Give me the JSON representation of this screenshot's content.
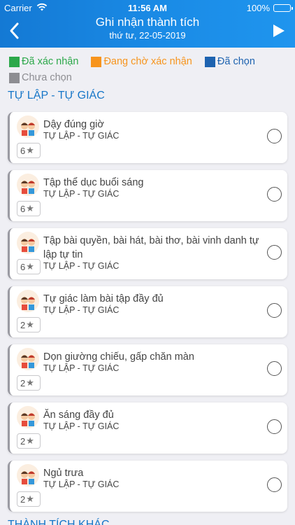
{
  "status_bar": {
    "carrier": "Carrier",
    "time": "11:56 AM",
    "battery": "100%"
  },
  "nav": {
    "title": "Ghi nhận thành tích",
    "subtitle": "thứ tư, 22-05-2019",
    "back_icon": "chevron-left-icon",
    "next_icon": "play-icon"
  },
  "legend": [
    {
      "label": "Đã xác nhận",
      "color": "#2ca84a"
    },
    {
      "label": "Đang chờ xác nhận",
      "color": "#f7941d"
    },
    {
      "label": "Đã chọn",
      "color": "#1e63b0"
    },
    {
      "label": "Chưa chọn",
      "color": "#8d8d92"
    }
  ],
  "section": {
    "title": "TỰ LẬP - TỰ GIÁC",
    "next_title": "THÀNH TÍCH KHÁC"
  },
  "items": [
    {
      "title": "Dậy đúng giờ",
      "category": "TỰ LẬP - TỰ GIÁC",
      "points": "6"
    },
    {
      "title": "Tập thể dục buổi sáng",
      "category": "TỰ LẬP - TỰ GIÁC",
      "points": "6"
    },
    {
      "title": "Tập bài quyền, bài hát, bài thơ, bài vinh danh tự lập tự tin",
      "category": "TỰ LẬP - TỰ GIÁC",
      "points": "6"
    },
    {
      "title": "Tự giác làm bài tập đầy đủ",
      "category": "TỰ LẬP - TỰ GIÁC",
      "points": "2"
    },
    {
      "title": "Dọn giường chiếu, gấp chăn màn",
      "category": "TỰ LẬP - TỰ GIÁC",
      "points": "2"
    },
    {
      "title": "Ăn sáng đầy đủ",
      "category": "TỰ LẬP - TỰ GIÁC",
      "points": "2"
    },
    {
      "title": "Ngủ trưa",
      "category": "TỰ LẬP - TỰ GIÁC",
      "points": "2"
    }
  ]
}
